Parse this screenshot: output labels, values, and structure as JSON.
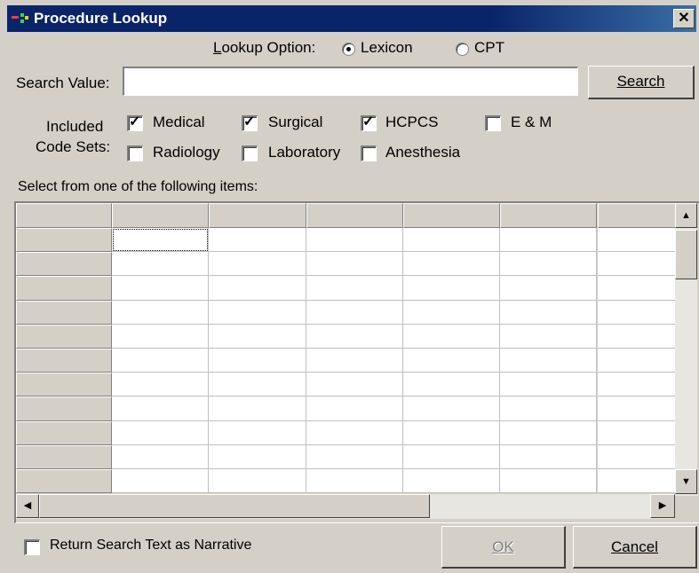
{
  "window": {
    "title": "Procedure Lookup",
    "close_label": "✕"
  },
  "lookup_option": {
    "label": "Lookup Option:",
    "options": [
      {
        "label": "Lexicon",
        "selected": true
      },
      {
        "label": "CPT",
        "selected": false
      }
    ]
  },
  "search": {
    "label": "Search Value:",
    "value": "",
    "placeholder": "",
    "button": "Search"
  },
  "code_sets": {
    "label_line1": "Included",
    "label_line2": "Code Sets:",
    "items": [
      {
        "label": "Medical",
        "checked": true
      },
      {
        "label": "Surgical",
        "checked": true
      },
      {
        "label": "HCPCS",
        "checked": true
      },
      {
        "label": "E & M",
        "checked": false
      },
      {
        "label": "Radiology",
        "checked": false
      },
      {
        "label": "Laboratory",
        "checked": false
      },
      {
        "label": "Anesthesia",
        "checked": false
      }
    ]
  },
  "grid": {
    "caption": "Select from one of the following items:",
    "rows": 11,
    "columns": 6
  },
  "narrative": {
    "label": "Return Search Text as Narrative",
    "checked": false
  },
  "buttons": {
    "ok": "OK",
    "cancel": "Cancel"
  },
  "colors": {
    "titlebar": "#0a246a",
    "face": "#d4d0c8"
  },
  "icons": [
    "app-icon",
    "close-icon",
    "scroll-up-icon",
    "scroll-down-icon",
    "scroll-left-icon",
    "scroll-right-icon"
  ]
}
